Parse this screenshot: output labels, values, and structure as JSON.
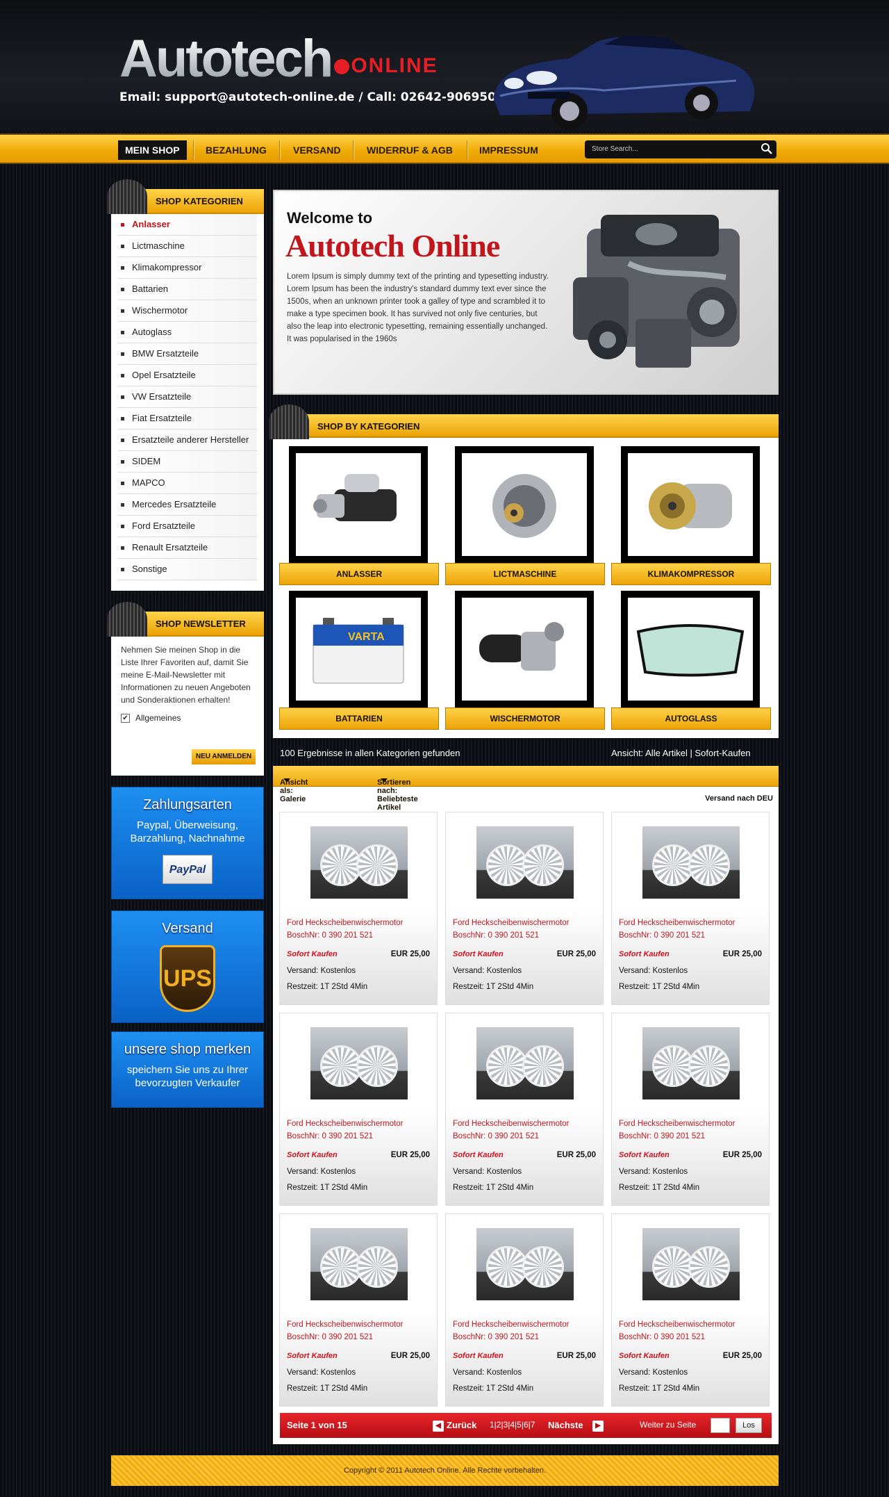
{
  "header": {
    "logo_main": "Autotech",
    "logo_sub": "ONLINE",
    "contact": "Email: support@autotech-online.de  /  Call:  02642-906950"
  },
  "nav": {
    "items": [
      "MEIN SHOP",
      "BEZAHLUNG",
      "VERSAND",
      "WIDERRUF & AGB",
      "IMPRESSUM"
    ],
    "search_placeholder": "Store Search..."
  },
  "sidebar": {
    "categories_title": "SHOP KATEGORIEN",
    "categories": [
      "Anlasser",
      "Lictmaschine",
      "Klimakompressor",
      "Battarien",
      "Wischermotor",
      "Autoglass",
      "BMW Ersatzteile",
      "Opel Ersatzteile",
      "VW Ersatzteile",
      "Fiat Ersatzteile",
      "Ersatzteile anderer Hersteller",
      "SIDEM",
      "MAPCO",
      "Mercedes Ersatzteile",
      "Ford Ersatzteile",
      "Renault Ersatzteile",
      "Sonstige"
    ],
    "newsletter_title": "SHOP NEWSLETTER",
    "newsletter_text": "Nehmen Sie meinen Shop in die Liste Ihrer Favoriten auf, damit Sie meine E-Mail-Newsletter mit Informationen zu neuen Angeboten und Sonderaktionen erhalten!",
    "newsletter_option": "Allgemeines",
    "newsletter_check": "✔",
    "newsletter_button": "NEU ANMELDEN",
    "payment_title": "Zahlungsarten",
    "payment_text": "Paypal, Überweisung, Barzahlung, Nachnahme",
    "paypal_logo": "PayPal",
    "shipping_title": "Versand",
    "ups_logo": "UPS",
    "favorite_title": "unsere shop merken",
    "favorite_text": "speichern Sie uns zu Ihrer bevorzugten Verkaufer"
  },
  "welcome": {
    "line1": "Welcome to",
    "line2": "Autotech Online",
    "text": "Lorem Ipsum is simply dummy text of the printing and typesetting industry. Lorem Ipsum has been the industry's standard dummy text ever since the 1500s, when an unknown printer took a galley of type and scrambled it to make a type specimen book. It has survived not only five centuries, but also the leap into electronic typesetting, remaining essentially unchanged. It was popularised in the 1960s"
  },
  "shop_by": {
    "title": "SHOP BY KATEGORIEN",
    "tiles": [
      "ANLASSER",
      "LICTMASCHINE",
      "KLIMAKOMPRESSOR",
      "BATTARIEN",
      "WISCHERMOTOR",
      "AUTOGLASS"
    ],
    "varta_label": "VARTA"
  },
  "results": {
    "count_text": "100 Ergebnisse in allen Kategorien gefunden",
    "view_text": "Ansicht: Alle Artikel  |  Sofort-Kaufen",
    "view_as": "Ansicht als: Galerie",
    "sort_by": "Sortieren nach: Beliebteste Artikel",
    "versand": "Versand nach DEU"
  },
  "products": [
    {
      "title": "Ford Heckscheibenwischermotor BoschNr: 0 390 201 521",
      "sofort": "Sofort Kaufen",
      "price": "EUR 25,00",
      "shipping": "Versand: Kostenlos",
      "remaining": "Restzeit: 1T 2Std 4Min"
    },
    {
      "title": "Ford Heckscheibenwischermotor BoschNr: 0 390 201 521",
      "sofort": "Sofort Kaufen",
      "price": "EUR 25,00",
      "shipping": "Versand: Kostenlos",
      "remaining": "Restzeit: 1T 2Std 4Min"
    },
    {
      "title": "Ford Heckscheibenwischermotor BoschNr: 0 390 201 521",
      "sofort": "Sofort Kaufen",
      "price": "EUR 25,00",
      "shipping": "Versand: Kostenlos",
      "remaining": "Restzeit: 1T 2Std 4Min"
    },
    {
      "title": "Ford Heckscheibenwischermotor BoschNr: 0 390 201 521",
      "sofort": "Sofort Kaufen",
      "price": "EUR 25,00",
      "shipping": "Versand: Kostenlos",
      "remaining": "Restzeit: 1T 2Std 4Min"
    },
    {
      "title": "Ford Heckscheibenwischermotor BoschNr: 0 390 201 521",
      "sofort": "Sofort Kaufen",
      "price": "EUR 25,00",
      "shipping": "Versand: Kostenlos",
      "remaining": "Restzeit: 1T 2Std 4Min"
    },
    {
      "title": "Ford Heckscheibenwischermotor BoschNr: 0 390 201 521",
      "sofort": "Sofort Kaufen",
      "price": "EUR 25,00",
      "shipping": "Versand: Kostenlos",
      "remaining": "Restzeit: 1T 2Std 4Min"
    },
    {
      "title": "Ford Heckscheibenwischermotor BoschNr: 0 390 201 521",
      "sofort": "Sofort Kaufen",
      "price": "EUR 25,00",
      "shipping": "Versand: Kostenlos",
      "remaining": "Restzeit: 1T 2Std 4Min"
    },
    {
      "title": "Ford Heckscheibenwischermotor BoschNr: 0 390 201 521",
      "sofort": "Sofort Kaufen",
      "price": "EUR 25,00",
      "shipping": "Versand: Kostenlos",
      "remaining": "Restzeit: 1T 2Std 4Min"
    },
    {
      "title": "Ford Heckscheibenwischermotor BoschNr: 0 390 201 521",
      "sofort": "Sofort Kaufen",
      "price": "EUR 25,00",
      "shipping": "Versand: Kostenlos",
      "remaining": "Restzeit: 1T 2Std 4Min"
    }
  ],
  "pager": {
    "page_info": "Seite 1 von 15",
    "prev": "Zurück",
    "pages": "1|2|3|4|5|6|7",
    "next": "Nächste",
    "goto": "Weiter zu Seite",
    "go": "Los",
    "prev_icon": "◀",
    "next_icon": "▶"
  },
  "footer": {
    "copyright": "Copyright © 2011 Autotech Online. Alle Rechte vorbehalten."
  },
  "colors": {
    "accent": "#f0ad0a",
    "brand_red": "#c0161c",
    "blue": "#1e8ff2"
  },
  "icons": [
    "search-icon",
    "tire-icon",
    "checkbox-icon",
    "paypal-logo",
    "ups-logo",
    "prev-arrow-icon",
    "next-arrow-icon"
  ]
}
